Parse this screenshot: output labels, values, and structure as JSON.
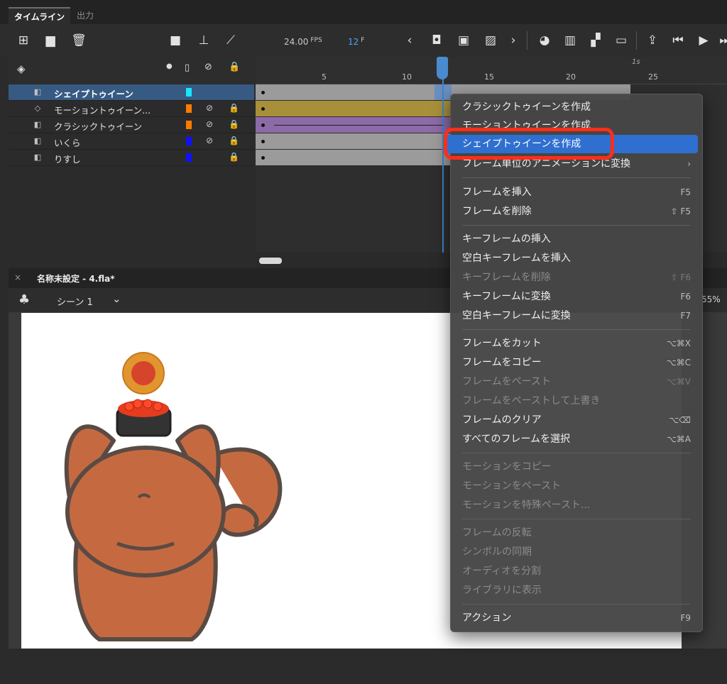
{
  "tabs": {
    "timeline": "タイムライン",
    "output": "出力"
  },
  "toolbar": {
    "fps_value": "24.00",
    "fps_unit": "FPS",
    "frame_value": "12",
    "frame_unit": "F"
  },
  "ruler": {
    "labels": [
      "5",
      "10",
      "15",
      "20",
      "25"
    ],
    "time_label": "1s"
  },
  "layers": [
    {
      "name": "シェイプトゥイーン",
      "color": "#19e6ff",
      "selected": true,
      "icon": "layer-icon",
      "eye_hidden": false,
      "locked": false
    },
    {
      "name": "モーショントゥイーン...",
      "color": "#ff7a00",
      "selected": false,
      "icon": "motion-tween-icon",
      "eye_hidden": true,
      "locked": true
    },
    {
      "name": "クラシックトゥイーン",
      "color": "#ff7a00",
      "selected": false,
      "icon": "layer-icon",
      "eye_hidden": true,
      "locked": true
    },
    {
      "name": "いくら",
      "color": "#1010ff",
      "selected": false,
      "icon": "layer-icon",
      "eye_hidden": true,
      "locked": true
    },
    {
      "name": "りすし",
      "color": "#1010ff",
      "selected": false,
      "icon": "layer-icon",
      "eye_hidden": false,
      "locked": true
    }
  ],
  "document": {
    "tab_label": "名称未設定 - 4.fla*",
    "scene": "シーン 1",
    "zoom": "55%"
  },
  "menu": {
    "highlight_color": "#2f6fd0",
    "items": [
      {
        "label": "クラシックトゥイーンを作成",
        "shortcut": "",
        "disabled": false
      },
      {
        "label": "モーショントゥイーンを作成",
        "shortcut": "",
        "disabled": false
      },
      {
        "label": "シェイプトゥイーンを作成",
        "shortcut": "",
        "disabled": false,
        "highlighted": true
      },
      {
        "label": "フレーム単位のアニメーションに変換",
        "shortcut": "›",
        "disabled": false
      },
      {
        "label": "フレームを挿入",
        "shortcut": "F5",
        "disabled": false
      },
      {
        "label": "フレームを削除",
        "shortcut": "⇧ F5",
        "disabled": false
      },
      {
        "label": "キーフレームの挿入",
        "shortcut": "",
        "disabled": false
      },
      {
        "label": "空白キーフレームを挿入",
        "shortcut": "",
        "disabled": false
      },
      {
        "label": "キーフレームを削除",
        "shortcut": "⇧ F6",
        "disabled": true
      },
      {
        "label": "キーフレームに変換",
        "shortcut": "F6",
        "disabled": false
      },
      {
        "label": "空白キーフレームに変換",
        "shortcut": "F7",
        "disabled": false
      },
      {
        "label": "フレームをカット",
        "shortcut": "⌥⌘X",
        "disabled": false
      },
      {
        "label": "フレームをコピー",
        "shortcut": "⌥⌘C",
        "disabled": false
      },
      {
        "label": "フレームをペースト",
        "shortcut": "⌥⌘V",
        "disabled": true
      },
      {
        "label": "フレームをペーストして上書き",
        "shortcut": "",
        "disabled": true
      },
      {
        "label": "フレームのクリア",
        "shortcut": "⌥⌫",
        "disabled": false
      },
      {
        "label": "すべてのフレームを選択",
        "shortcut": "⌥⌘A",
        "disabled": false
      },
      {
        "label": "モーションをコピー",
        "shortcut": "",
        "disabled": true
      },
      {
        "label": "モーションをペースト",
        "shortcut": "",
        "disabled": true
      },
      {
        "label": "モーションを特殊ペースト...",
        "shortcut": "",
        "disabled": true
      },
      {
        "label": "フレームの反転",
        "shortcut": "",
        "disabled": true
      },
      {
        "label": "シンボルの同期",
        "shortcut": "",
        "disabled": true
      },
      {
        "label": "オーディオを分割",
        "shortcut": "",
        "disabled": true
      },
      {
        "label": "ライブラリに表示",
        "shortcut": "",
        "disabled": true
      },
      {
        "label": "アクション",
        "shortcut": "F9",
        "disabled": false
      }
    ]
  }
}
